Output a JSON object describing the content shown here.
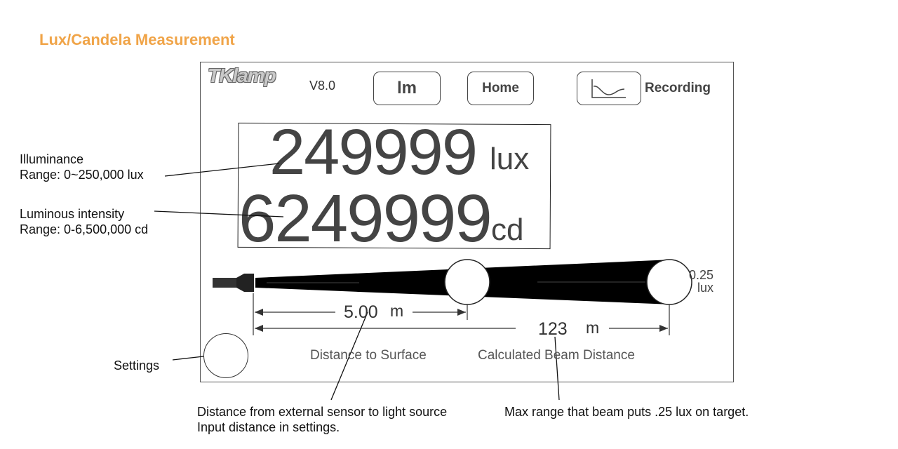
{
  "page_title": "Lux/Candela Measurement",
  "header": {
    "logo": "TKlamp",
    "version": "V8.0",
    "lm_button": "lm",
    "home_button": "Home",
    "recording_label": "Recording"
  },
  "readout": {
    "illuminance_value": "249999",
    "illuminance_unit": "lux",
    "intensity_value": "6249999",
    "intensity_unit": "cd"
  },
  "beam": {
    "end_lux_value": "0.25",
    "end_lux_unit": "lux",
    "surface_distance_value": "5.00",
    "surface_distance_unit": "m",
    "beam_distance_value": "123",
    "beam_distance_unit": "m",
    "surface_label": "Distance to Surface",
    "beam_label": "Calculated Beam Distance"
  },
  "annotations": {
    "illuminance_title": "Illuminance",
    "illuminance_range": "Range: 0~250,000 lux",
    "intensity_title": "Luminous intensity",
    "intensity_range": "Range: 0-6,500,000 cd",
    "settings": "Settings",
    "sensor_distance_line1": "Distance from external sensor to light source",
    "sensor_distance_line2": "Input distance in settings.",
    "max_range": "Max range that beam puts .25 lux on target."
  },
  "icons": {
    "recording": "graph-curve-icon",
    "light_source": "flashlight-icon"
  },
  "colors": {
    "title": "#f0a448",
    "beam": "#000000",
    "value_text": "#444444"
  }
}
